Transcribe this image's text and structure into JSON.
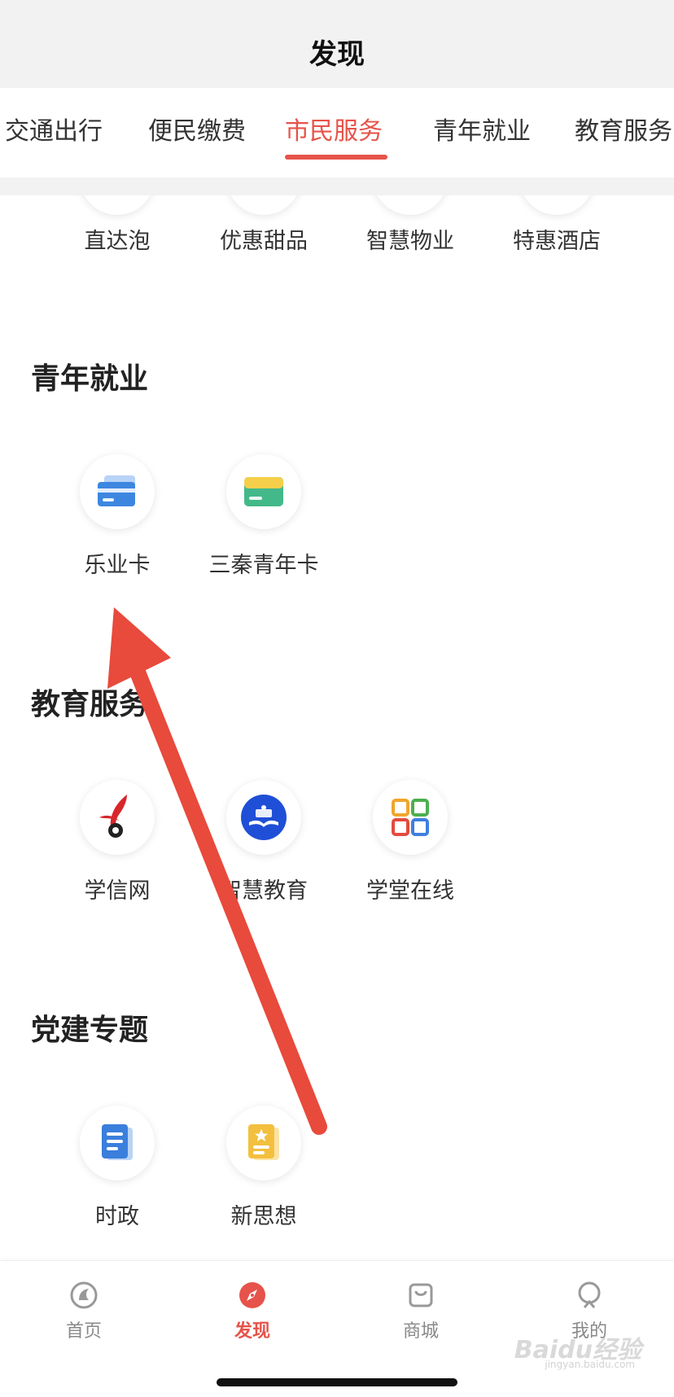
{
  "header": {
    "title": "发现"
  },
  "tabs": [
    {
      "label": "交通出行"
    },
    {
      "label": "便民缴费"
    },
    {
      "label": "市民服务"
    },
    {
      "label": "青年就业"
    },
    {
      "label": "教育服务"
    }
  ],
  "active_tab": "市民服务",
  "top_row": {
    "items": [
      {
        "label": "直达泡"
      },
      {
        "label": "优惠甜品"
      },
      {
        "label": "智慧物业"
      },
      {
        "label": "特惠酒店"
      }
    ]
  },
  "sections": [
    {
      "title": "青年就业",
      "items": [
        {
          "label": "乐业卡",
          "icon": "blue-card-icon"
        },
        {
          "label": "三秦青年卡",
          "icon": "green-card-icon"
        }
      ]
    },
    {
      "title": "教育服务",
      "items": [
        {
          "label": "学信网",
          "icon": "chsi-logo-icon"
        },
        {
          "label": "智慧教育",
          "icon": "smart-education-logo-icon"
        },
        {
          "label": "学堂在线",
          "icon": "xuetangx-logo-icon"
        }
      ]
    },
    {
      "title": "党建专题",
      "items": [
        {
          "label": "时政",
          "icon": "document-icon"
        },
        {
          "label": "新思想",
          "icon": "star-document-icon"
        }
      ]
    }
  ],
  "bottom_nav": [
    {
      "label": "首页",
      "icon": "home-icon"
    },
    {
      "label": "发现",
      "icon": "compass-icon"
    },
    {
      "label": "商城",
      "icon": "shopping-bag-icon"
    },
    {
      "label": "我的",
      "icon": "profile-icon"
    }
  ],
  "active_nav": "发现",
  "watermark": {
    "text": "Baidu经验",
    "sub": "jingyan.baidu.com"
  },
  "colors": {
    "accent": "#e6534a",
    "header_bg": "#f2f2f2",
    "arrow": "#e84a3c"
  }
}
